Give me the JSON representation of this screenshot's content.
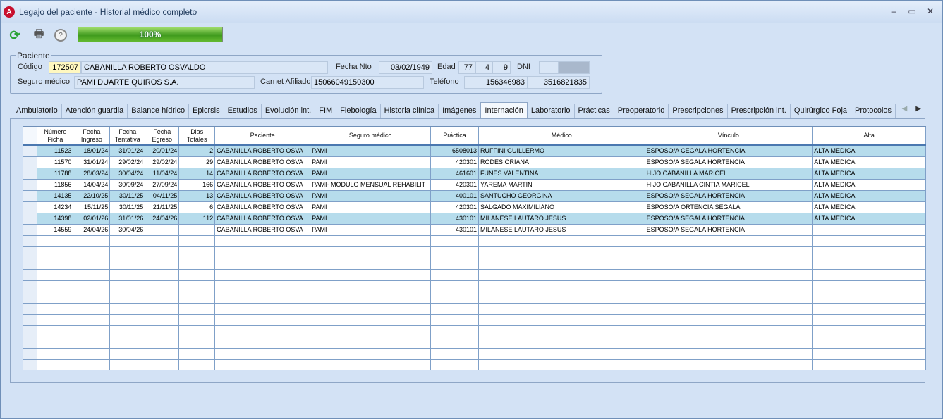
{
  "window": {
    "title": "Legajo del paciente - Historial médico completo",
    "icon_letter": "A",
    "controls": {
      "minimize": "–",
      "maximize": "▭",
      "close": "✕"
    }
  },
  "toolbar": {
    "icons": [
      "refresh-icon",
      "print-icon",
      "help-icon"
    ],
    "progress_value": 100,
    "progress_label": "100%"
  },
  "patient": {
    "legend": "Paciente",
    "codigo_label": "Código",
    "codigo": "172507",
    "nombre": "CABANILLA ROBERTO OSVALDO",
    "fecha_nto_label": "Fecha Nto",
    "fecha_nto": "03/02/1949",
    "edad_label": "Edad",
    "edad_years": "77",
    "edad_months": "4",
    "edad_days": "9",
    "dni_label": "DNI",
    "dni": "",
    "seguro_label": "Seguro médico",
    "seguro": "PAMI DUARTE QUIROS S.A.",
    "carnet_label": "Carnet Afiliado",
    "carnet": "15066049150300",
    "telefono_label": "Teléfono",
    "telefono1": "156346983",
    "telefono2": "3516821835"
  },
  "tabs": [
    "Ambulatorio",
    "Atención guardia",
    "Balance hídrico",
    "Epicrsis",
    "Estudios",
    "Evolución int.",
    "FIM",
    "Flebología",
    "Historia clínica",
    "Imágenes",
    "Internación",
    "Laboratorio",
    "Prácticas",
    "Preoperatorio",
    "Prescripciones",
    "Prescripción int.",
    "Quirúrgico Foja",
    "Protocolos"
  ],
  "active_tab": "Internación",
  "tab_arrows": {
    "left": "◀",
    "right": "▶"
  },
  "table": {
    "columns": [
      {
        "l1": "Número",
        "l2": "Ficha"
      },
      {
        "l1": "Fecha",
        "l2": "Ingreso"
      },
      {
        "l1": "Fecha",
        "l2": "Tentativa"
      },
      {
        "l1": "Fecha",
        "l2": "Egreso"
      },
      {
        "l1": "Dias",
        "l2": "Totales"
      },
      {
        "l1": "Paciente",
        "l2": ""
      },
      {
        "l1": "Seguro médico",
        "l2": ""
      },
      {
        "l1": "Práctica",
        "l2": ""
      },
      {
        "l1": "Médico",
        "l2": ""
      },
      {
        "l1": "Vínculo",
        "l2": ""
      },
      {
        "l1": "Alta",
        "l2": ""
      }
    ],
    "rows": [
      [
        "11523",
        "18/01/24",
        "31/01/24",
        "20/01/24",
        "2",
        "CABANILLA ROBERTO OSVA",
        "PAMI",
        "6508013",
        "RUFFINI GUILLERMO",
        "ESPOSO/A CEGALA HORTENCIA",
        "ALTA MEDICA"
      ],
      [
        "11570",
        "31/01/24",
        "29/02/24",
        "29/02/24",
        "29",
        "CABANILLA ROBERTO OSVA",
        "PAMI",
        "420301",
        "RODES ORIANA",
        "ESPOSO/A SEGALA HORTENCIA",
        "ALTA MEDICA"
      ],
      [
        "11788",
        "28/03/24",
        "30/04/24",
        "11/04/24",
        "14",
        "CABANILLA ROBERTO OSVA",
        "PAMI",
        "461601",
        "FUNES VALENTINA",
        "HIJO CABANILLA MARICEL",
        "ALTA MEDICA"
      ],
      [
        "11856",
        "14/04/24",
        "30/09/24",
        "27/09/24",
        "166",
        "CABANILLA ROBERTO OSVA",
        "PAMI- MODULO MENSUAL REHABILIT",
        "420301",
        "YAREMA MARTIN",
        "HIJO CABANILLA CINTIA MARICEL",
        "ALTA MEDICA"
      ],
      [
        "14135",
        "22/10/25",
        "30/11/25",
        "04/11/25",
        "13",
        "CABANILLA ROBERTO OSVA",
        "PAMI",
        "400101",
        "SANTUCHO GEORGINA",
        "ESPOSO/A SEGALA HORTENCIA",
        "ALTA MEDICA"
      ],
      [
        "14234",
        "15/11/25",
        "30/11/25",
        "21/11/25",
        "6",
        "CABANILLA ROBERTO OSVA",
        "PAMI",
        "420301",
        "SALGADO MAXIMILIANO",
        "ESPOSO/A ORTENCIA SEGALA",
        "ALTA MEDICA"
      ],
      [
        "14398",
        "02/01/26",
        "31/01/26",
        "24/04/26",
        "112",
        "CABANILLA ROBERTO OSVA",
        "PAMI",
        "430101",
        "MILANESE LAUTARO JESUS",
        "ESPOSO/A SEGALA HORTENCIA",
        "ALTA MEDICA"
      ],
      [
        "14559",
        "24/04/26",
        "30/04/26",
        "",
        "",
        "CABANILLA ROBERTO OSVA",
        "PAMI",
        "430101",
        "MILANESE LAUTARO JESUS",
        "ESPOSO/A SEGALA HORTENCIA",
        ""
      ]
    ],
    "empty_rows": 12
  }
}
